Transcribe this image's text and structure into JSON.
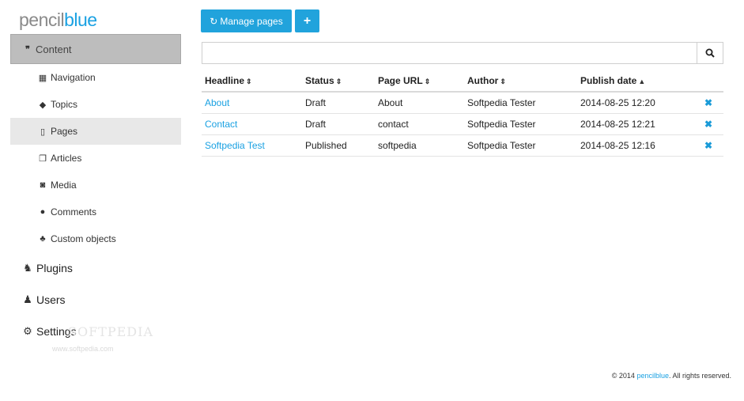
{
  "logo": {
    "part1": "pencil",
    "part2": "blue"
  },
  "sidebar": {
    "content": {
      "label": "Content",
      "icon": "quote-icon"
    },
    "sub_items": [
      {
        "label": "Navigation",
        "icon": "th-large-icon"
      },
      {
        "label": "Topics",
        "icon": "tag-icon"
      },
      {
        "label": "Pages",
        "icon": "file-icon",
        "active": true
      },
      {
        "label": "Articles",
        "icon": "copy-icon"
      },
      {
        "label": "Media",
        "icon": "camera-icon"
      },
      {
        "label": "Comments",
        "icon": "comments-icon"
      },
      {
        "label": "Custom objects",
        "icon": "sitemap-icon"
      }
    ],
    "main_items": [
      {
        "label": "Plugins",
        "icon": "puzzle-icon"
      },
      {
        "label": "Users",
        "icon": "users-icon"
      },
      {
        "label": "Settings",
        "icon": "cogs-icon"
      }
    ]
  },
  "watermark": {
    "text": "SOFTPEDIA",
    "sub": "www.softpedia.com"
  },
  "toolbar": {
    "manage_label": "Manage pages",
    "add_label": "+"
  },
  "search": {
    "value": "",
    "placeholder": ""
  },
  "table": {
    "headers": [
      "Headline",
      "Status",
      "Page URL",
      "Author",
      "Publish date"
    ],
    "header_sort": [
      "⇕",
      "⇕",
      "⇕",
      "⇕",
      "▲"
    ],
    "rows": [
      {
        "headline": "About",
        "status": "Draft",
        "url": "About",
        "author": "Softpedia Tester",
        "date": "2014-08-25 12:20"
      },
      {
        "headline": "Contact",
        "status": "Draft",
        "url": "contact",
        "author": "Softpedia Tester",
        "date": "2014-08-25 12:21"
      },
      {
        "headline": "Softpedia Test",
        "status": "Published",
        "url": "softpedia",
        "author": "Softpedia Tester",
        "date": "2014-08-25 12:16"
      }
    ],
    "delete_glyph": "✖"
  },
  "footer": {
    "prefix": "© 2014 ",
    "brand": "pencilblue",
    "suffix": ". All rights reserved."
  },
  "colors": {
    "accent": "#21a3dc",
    "sidebar_active": "#bdbdbd"
  }
}
